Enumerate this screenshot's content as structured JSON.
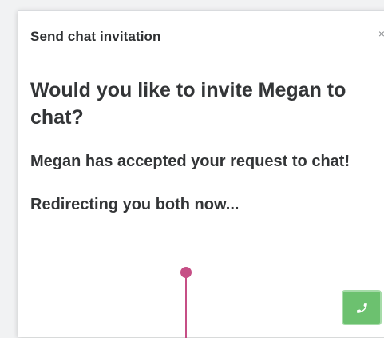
{
  "dialog": {
    "title": "Send chat invitation",
    "close_glyph": "×",
    "question": "Would you like to invite Megan to chat?",
    "accepted_message": "Megan has accepted your request to chat!",
    "redirect_message": "Redirecting you both now..."
  },
  "footer": {
    "call_button_icon": "phone-icon"
  },
  "colors": {
    "accent_green": "#6cc16f",
    "annotation_pink": "#c64f86",
    "text_dark": "#333537"
  }
}
